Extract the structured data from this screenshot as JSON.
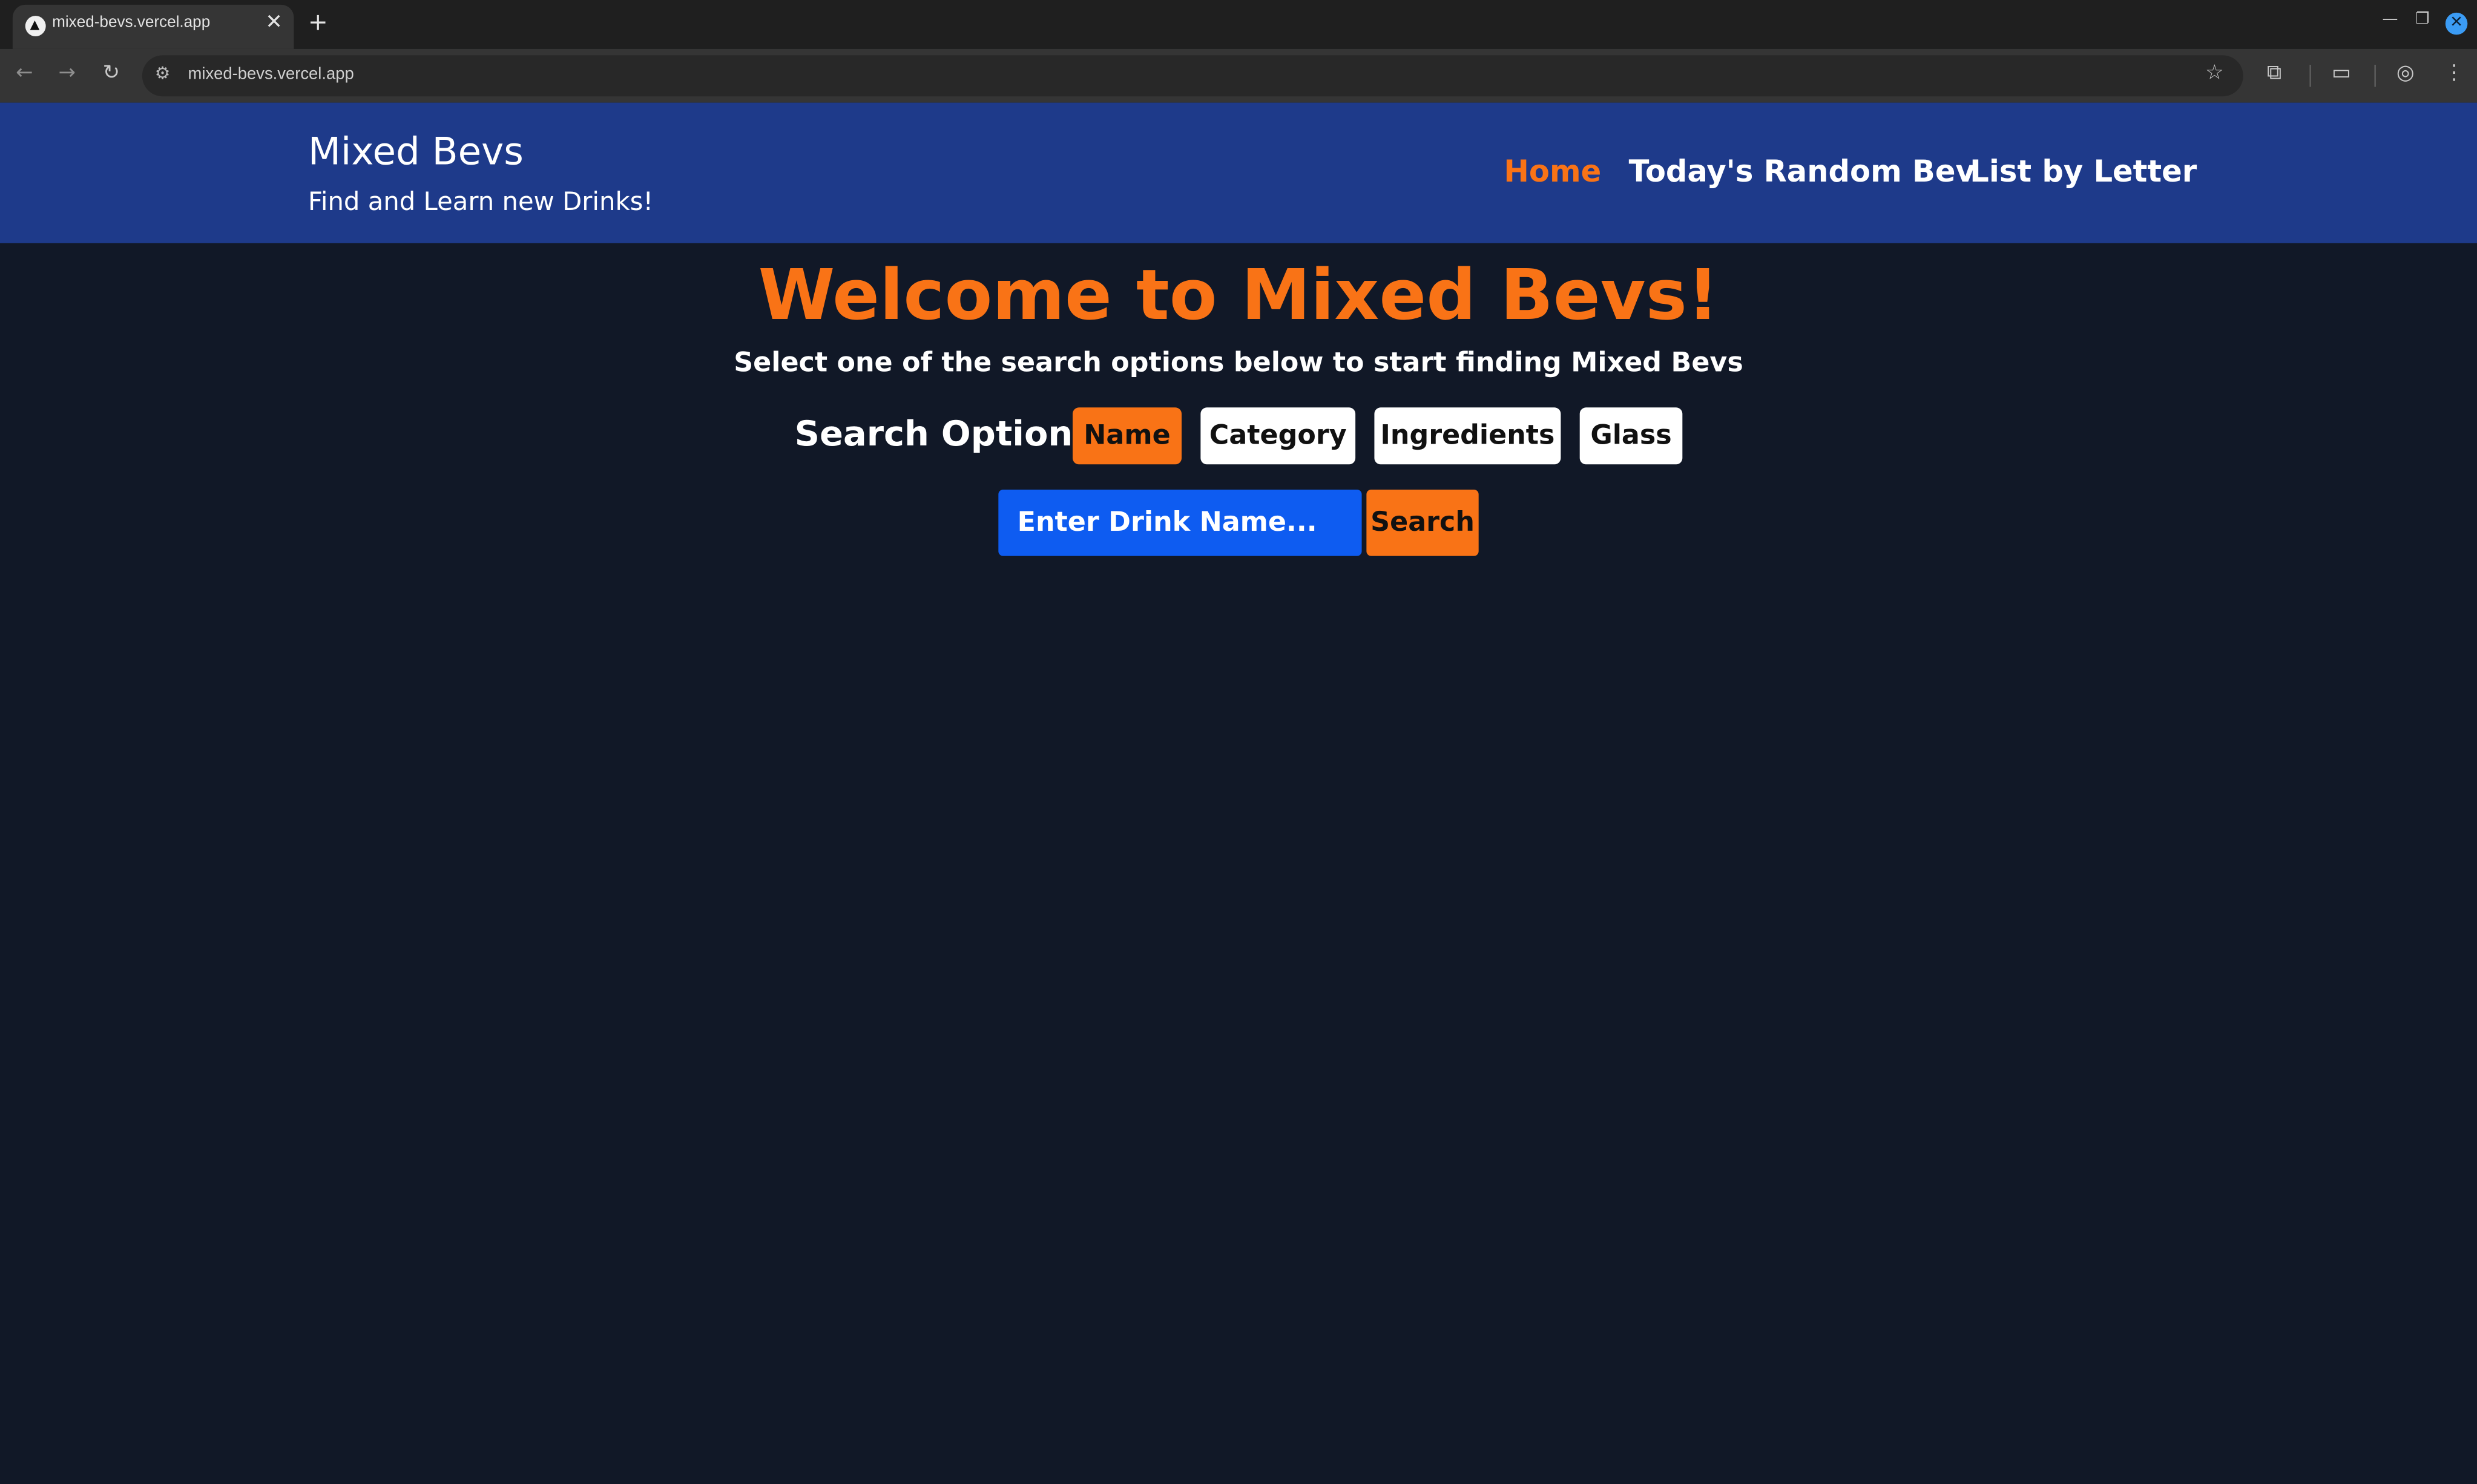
{
  "browser": {
    "tab_title": "mixed-bevs.vercel.app",
    "url": "mixed-bevs.vercel.app"
  },
  "header": {
    "brand_title": "Mixed Bevs",
    "brand_subtitle": "Find and Learn new Drinks!",
    "nav": [
      {
        "label": "Home",
        "active": true
      },
      {
        "label": "Today's Random Bev",
        "active": false
      },
      {
        "label": "List by Letter",
        "active": false
      }
    ]
  },
  "main": {
    "welcome_title": "Welcome to Mixed Bevs!",
    "subtitle": "Select one of the search options below to start finding Mixed Bevs",
    "search_options_label": "Search Options:",
    "search_options": [
      {
        "label": "Name",
        "selected": true
      },
      {
        "label": "Category",
        "selected": false
      },
      {
        "label": "Ingredients",
        "selected": false
      },
      {
        "label": "Glass",
        "selected": false
      }
    ],
    "search_placeholder": "Enter Drink Name...",
    "search_button": "Search"
  },
  "colors": {
    "header_bg": "#1e3a8a",
    "page_bg": "#111827",
    "accent": "#f97316",
    "input_bg": "#0e5cf1"
  },
  "icons": [
    "back-arrow-icon",
    "forward-arrow-icon",
    "reload-icon",
    "site-info-icon",
    "bookmark-star-icon",
    "extensions-icon",
    "tab-search-icon",
    "profile-icon",
    "menu-dots-icon",
    "close-icon",
    "new-tab-icon"
  ]
}
